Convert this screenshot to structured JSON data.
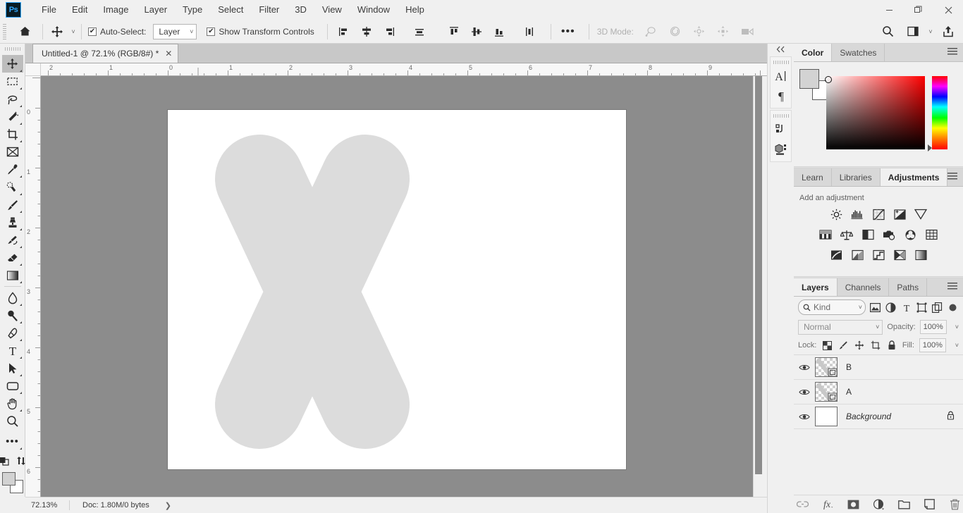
{
  "app": {
    "logo": "Ps",
    "menus": [
      "File",
      "Edit",
      "Image",
      "Layer",
      "Type",
      "Select",
      "Filter",
      "3D",
      "View",
      "Window",
      "Help"
    ],
    "window_controls": {
      "minimize": "—",
      "maximize": "❐",
      "close": "✕"
    }
  },
  "options_bar": {
    "home_icon": "home-icon",
    "tool_icon": "move-tool-icon",
    "auto_select_label": "Auto-Select:",
    "auto_select_checked": true,
    "auto_select_scope": "Layer",
    "show_transform_label": "Show Transform Controls",
    "show_transform_checked": true,
    "align_left_icon": "align-left-edges-icon",
    "align_hcenter_icon": "align-horizontal-centers-icon",
    "align_right_icon": "align-right-edges-icon",
    "distribute_icon": "distribute-vertical-centers-icon",
    "align_top_icon": "align-top-edges-icon",
    "align_vcenter_icon": "align-vertical-centers-icon",
    "align_bottom_icon": "align-bottom-edges-icon",
    "distribute_h_icon": "distribute-horizontal-icon",
    "more_icon": "more-options-icon",
    "mode3d_label": "3D Mode:",
    "mode3d_icons": [
      "3d-rotate-icon",
      "3d-roll-icon",
      "3d-pan-icon",
      "3d-slide-icon",
      "3d-camera-icon"
    ],
    "search_icon": "search-icon",
    "workspace_icon": "workspace-switcher-icon",
    "share_icon": "share-icon"
  },
  "document": {
    "tab_title": "Untitled-1 @ 72.1% (RGB/8#) *",
    "close_icon": "close-tab-icon"
  },
  "toolbar": {
    "tools": [
      {
        "name": "move-tool",
        "icon": "move-icon",
        "active": true,
        "has_flyout": true
      },
      {
        "name": "rectangular-marquee-tool",
        "icon": "marquee-icon",
        "active": false,
        "has_flyout": true
      },
      {
        "name": "lasso-tool",
        "icon": "lasso-icon",
        "active": false,
        "has_flyout": true
      },
      {
        "name": "object-selection-tool",
        "icon": "magic-wand-icon",
        "active": false,
        "has_flyout": true
      },
      {
        "name": "crop-tool",
        "icon": "crop-icon",
        "active": false,
        "has_flyout": true
      },
      {
        "name": "frame-tool",
        "icon": "frame-icon",
        "active": false,
        "has_flyout": false
      },
      {
        "name": "eyedropper-tool",
        "icon": "eyedropper-icon",
        "active": false,
        "has_flyout": true
      },
      {
        "name": "spot-healing-brush-tool",
        "icon": "healing-brush-icon",
        "active": false,
        "has_flyout": true
      },
      {
        "name": "brush-tool",
        "icon": "brush-icon",
        "active": false,
        "has_flyout": true
      },
      {
        "name": "clone-stamp-tool",
        "icon": "clone-stamp-icon",
        "active": false,
        "has_flyout": true
      },
      {
        "name": "history-brush-tool",
        "icon": "history-brush-icon",
        "active": false,
        "has_flyout": true
      },
      {
        "name": "eraser-tool",
        "icon": "eraser-icon",
        "active": false,
        "has_flyout": true
      },
      {
        "name": "gradient-tool",
        "icon": "gradient-icon",
        "active": false,
        "has_flyout": true
      },
      {
        "name": "blur-tool",
        "icon": "blur-droplet-icon",
        "active": false,
        "has_flyout": true
      },
      {
        "name": "dodge-tool",
        "icon": "dodge-icon",
        "active": false,
        "has_flyout": true
      },
      {
        "name": "pen-tool",
        "icon": "pen-icon",
        "active": false,
        "has_flyout": true
      },
      {
        "name": "type-tool",
        "icon": "type-icon",
        "active": false,
        "has_flyout": true
      },
      {
        "name": "path-selection-tool",
        "icon": "path-arrow-icon",
        "active": false,
        "has_flyout": true
      },
      {
        "name": "rectangle-tool",
        "icon": "rounded-rect-icon",
        "active": false,
        "has_flyout": true
      },
      {
        "name": "hand-tool",
        "icon": "hand-icon",
        "active": false,
        "has_flyout": true
      },
      {
        "name": "zoom-tool",
        "icon": "zoom-magnifier-icon",
        "active": false,
        "has_flyout": false
      },
      {
        "name": "edit-toolbar",
        "icon": "ellipsis-icon",
        "active": false,
        "has_flyout": true
      }
    ],
    "quickmask_icon": "quick-mask-icon",
    "swap_colors_icon": "swap-colors-icon",
    "foreground_color": "#d2d2d2",
    "background_color": "#ffffff"
  },
  "rulers": {
    "unit": "inches",
    "horizontal_labels": [
      "2",
      "1",
      "0",
      "1",
      "2",
      "3",
      "4",
      "5",
      "6",
      "7",
      "8",
      "9"
    ],
    "vertical_labels": [
      "0",
      "1",
      "2",
      "3",
      "4",
      "5",
      "6"
    ]
  },
  "canvas": {
    "artboard_background": "#ffffff",
    "workspace_background": "#8c8c8c",
    "shape_name": "x-chromosome-shape",
    "shape_color": "#dcdcdc"
  },
  "status_bar": {
    "zoom": "72.13%",
    "doc_info": "Doc: 1.80M/0 bytes",
    "expand_icon": "status-expand-icon"
  },
  "rail": {
    "collapse_icon": "collapse-panels-icon",
    "groups": [
      {
        "icons": [
          {
            "name": "character-panel-icon",
            "glyph": "A"
          },
          {
            "name": "paragraph-panel-icon",
            "glyph": "¶"
          }
        ]
      },
      {
        "icons": [
          {
            "name": "actions-panel-icon",
            "glyph": "actions"
          },
          {
            "name": "3d-panel-icon",
            "glyph": "3d"
          }
        ]
      }
    ]
  },
  "color_panel": {
    "tabs": [
      {
        "label": "Color",
        "active": true
      },
      {
        "label": "Swatches",
        "active": false
      }
    ],
    "menu_icon": "panel-menu-icon",
    "foreground": "#d3d3d3",
    "background": "#ffffff",
    "spectrum_base": "#ff0000"
  },
  "adjustments_panel": {
    "tabs": [
      {
        "label": "Learn",
        "active": false
      },
      {
        "label": "Libraries",
        "active": false
      },
      {
        "label": "Adjustments",
        "active": true
      }
    ],
    "menu_icon": "panel-menu-icon",
    "heading": "Add an adjustment",
    "rows": [
      [
        {
          "name": "brightness-contrast-adjustment-icon"
        },
        {
          "name": "levels-adjustment-icon"
        },
        {
          "name": "curves-adjustment-icon"
        },
        {
          "name": "exposure-adjustment-icon"
        },
        {
          "name": "vibrance-adjustment-icon"
        }
      ],
      [
        {
          "name": "hue-saturation-adjustment-icon"
        },
        {
          "name": "color-balance-adjustment-icon"
        },
        {
          "name": "black-white-adjustment-icon"
        },
        {
          "name": "photo-filter-adjustment-icon"
        },
        {
          "name": "channel-mixer-adjustment-icon"
        },
        {
          "name": "color-lookup-adjustment-icon"
        }
      ],
      [
        {
          "name": "invert-adjustment-icon"
        },
        {
          "name": "posterize-adjustment-icon"
        },
        {
          "name": "threshold-adjustment-icon"
        },
        {
          "name": "selective-color-adjustment-icon"
        },
        {
          "name": "gradient-map-adjustment-icon"
        }
      ]
    ]
  },
  "layers_panel": {
    "tabs": [
      {
        "label": "Layers",
        "active": true
      },
      {
        "label": "Channels",
        "active": false
      },
      {
        "label": "Paths",
        "active": false
      }
    ],
    "menu_icon": "panel-menu-icon",
    "filter": {
      "search_icon": "search-icon",
      "kind_label": "Kind",
      "type_filters": [
        {
          "name": "filter-pixel-layers-icon"
        },
        {
          "name": "filter-adjustment-layers-icon"
        },
        {
          "name": "filter-type-layers-icon"
        },
        {
          "name": "filter-shape-layers-icon"
        },
        {
          "name": "filter-smart-objects-icon"
        }
      ],
      "toggle_filter_icon": "toggle-layer-filtering-icon"
    },
    "blend_mode": "Normal",
    "opacity_label": "Opacity:",
    "opacity_value": "100%",
    "lock_label": "Lock:",
    "lock_icons": [
      {
        "name": "lock-transparent-pixels-icon"
      },
      {
        "name": "lock-image-pixels-icon"
      },
      {
        "name": "lock-position-icon"
      },
      {
        "name": "lock-artboard-nesting-icon"
      },
      {
        "name": "lock-all-icon"
      }
    ],
    "fill_label": "Fill:",
    "fill_value": "100%",
    "layers": [
      {
        "name": "B",
        "visible": true,
        "locked": false,
        "italic": false,
        "thumb": "shape-thumb"
      },
      {
        "name": "A",
        "visible": true,
        "locked": false,
        "italic": false,
        "thumb": "shape-thumb"
      },
      {
        "name": "Background",
        "visible": true,
        "locked": true,
        "italic": true,
        "thumb": "white-thumb"
      }
    ],
    "bottom_buttons": [
      {
        "name": "link-layers-button",
        "icon": "link-icon"
      },
      {
        "name": "layer-style-button",
        "icon": "fx-icon"
      },
      {
        "name": "add-layer-mask-button",
        "icon": "mask-icon"
      },
      {
        "name": "new-adjustment-layer-button",
        "icon": "half-circle-icon"
      },
      {
        "name": "new-group-button",
        "icon": "folder-icon"
      },
      {
        "name": "new-layer-button",
        "icon": "new-layer-icon"
      },
      {
        "name": "delete-layer-button",
        "icon": "trash-icon"
      }
    ]
  }
}
